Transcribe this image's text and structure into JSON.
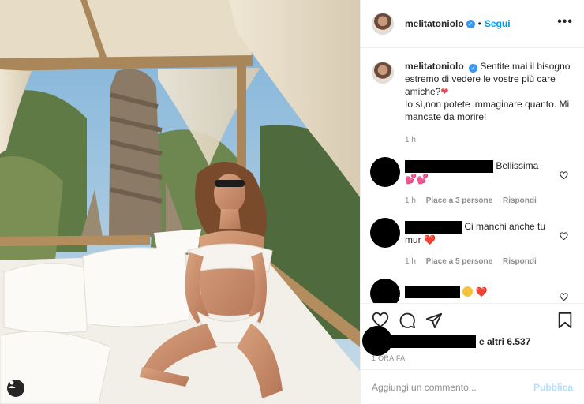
{
  "post": {
    "username": "melitatoniolo",
    "follow_label": "Segui",
    "separator": "•",
    "more_label": "•••"
  },
  "caption": {
    "username": "melitatoniolo",
    "text_line1": "Sentite mai il bisogno estremo di vedere le vostre più care amiche?",
    "text_line2": "Io sì,non potete immaginare quanto. Mi mancate da morire!",
    "time": "1 h"
  },
  "comments": [
    {
      "text": "Bellissima",
      "emoji": "💕💕",
      "time": "1 h",
      "likes": "Piace a 3 persone",
      "reply": "Rispondi"
    },
    {
      "text": "Ci manchi anche tu mur",
      "emoji": "❤️",
      "time": "1 h",
      "likes": "Piace a 5 persone",
      "reply": "Rispondi"
    },
    {
      "text": "",
      "emoji": "❤️",
      "time": "",
      "likes": "",
      "reply": ""
    }
  ],
  "likes_summary": {
    "text": "e altri 6.537",
    "ago": "1 ORA FA"
  },
  "composer": {
    "placeholder": "Aggiungi un commento...",
    "publish": "Pubblica"
  },
  "colors": {
    "accent": "#0095f6",
    "verified": "#3897f0",
    "heart": "#ed4956",
    "muted": "#8e8e8e",
    "publish_disabled": "#b2dffc"
  }
}
